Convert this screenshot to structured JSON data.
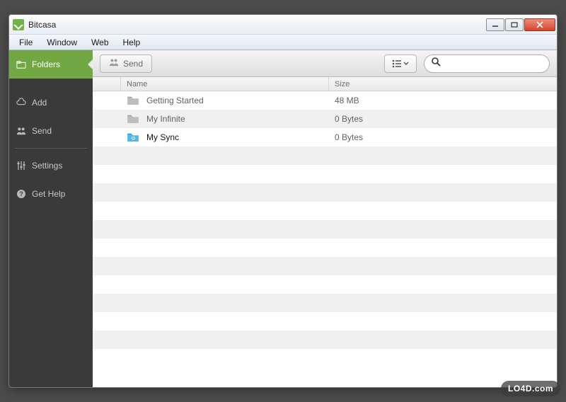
{
  "window": {
    "title": "Bitcasa"
  },
  "menubar": {
    "items": [
      "File",
      "Window",
      "Web",
      "Help"
    ]
  },
  "sidebar": {
    "items": [
      {
        "label": "Folders",
        "icon": "folders-icon",
        "active": true
      },
      {
        "label": "Add",
        "icon": "cloud-icon"
      },
      {
        "label": "Send",
        "icon": "people-icon"
      },
      {
        "label": "Settings",
        "icon": "sliders-icon"
      },
      {
        "label": "Get Help",
        "icon": "help-icon"
      }
    ]
  },
  "toolbar": {
    "send_label": "Send",
    "view_icon": "list-view-icon",
    "search_placeholder": ""
  },
  "table": {
    "columns": {
      "name": "Name",
      "size": "Size"
    },
    "rows": [
      {
        "name": "Getting Started",
        "size": "48 MB",
        "icon": "folder-icon",
        "selected": false
      },
      {
        "name": "My Infinite",
        "size": "0 Bytes",
        "icon": "folder-icon",
        "selected": false
      },
      {
        "name": "My Sync",
        "size": "0 Bytes",
        "icon": "sync-folder-icon",
        "selected": true
      }
    ],
    "blank_rows": 12
  },
  "colors": {
    "accent_green": "#71a844",
    "sidebar_bg": "#3a3a3a"
  },
  "watermark": "LO4D.com"
}
